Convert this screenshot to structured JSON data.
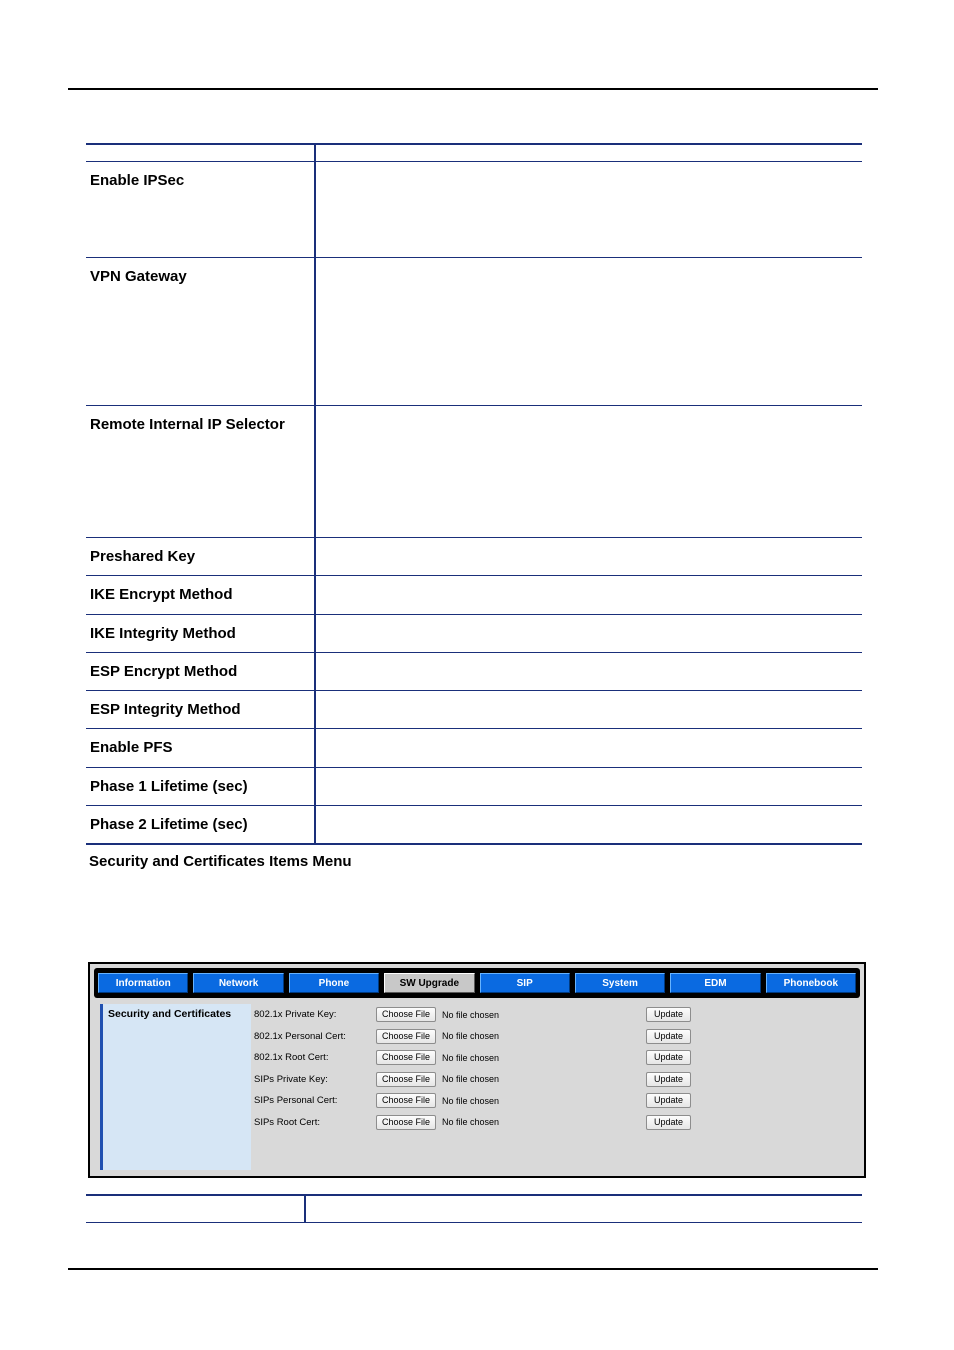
{
  "document": {
    "caption": "Security and Certificates Items Menu",
    "param_table": {
      "rows": [
        {
          "label": "",
          "value": "",
          "header": true
        },
        {
          "label": "Enable IPSec",
          "value": ""
        },
        {
          "label": "VPN Gateway",
          "value": ""
        },
        {
          "label": "Remote Internal IP Selector",
          "value": ""
        },
        {
          "label": "Preshared Key",
          "value": ""
        },
        {
          "label": "IKE Encrypt Method",
          "value": ""
        },
        {
          "label": "IKE Integrity Method",
          "value": ""
        },
        {
          "label": "ESP Encrypt Method",
          "value": ""
        },
        {
          "label": "ESP Integrity Method",
          "value": ""
        },
        {
          "label": "Enable PFS",
          "value": ""
        },
        {
          "label": "Phase 1 Lifetime (sec)",
          "value": ""
        },
        {
          "label": "Phase 2 Lifetime (sec)",
          "value": ""
        }
      ]
    },
    "bottom_table": {
      "label": "",
      "value": ""
    }
  },
  "webui": {
    "tabs": [
      {
        "label": "Information",
        "selected": false
      },
      {
        "label": "Network",
        "selected": false
      },
      {
        "label": "Phone",
        "selected": false
      },
      {
        "label": "SW Upgrade",
        "selected": true
      },
      {
        "label": "SIP",
        "selected": false
      },
      {
        "label": "System",
        "selected": false
      },
      {
        "label": "EDM",
        "selected": false
      },
      {
        "label": "Phonebook",
        "selected": false
      }
    ],
    "sidebar": {
      "title": "Security and Certificates"
    },
    "form": {
      "choose_file_label": "Choose File",
      "no_file_label": "No file chosen",
      "update_label": "Update",
      "rows": [
        {
          "label": "802.1x Private Key:"
        },
        {
          "label": "802.1x Personal Cert:"
        },
        {
          "label": "802.1x Root Cert:"
        },
        {
          "label": "SIPs Private Key:"
        },
        {
          "label": "SIPs Personal Cert:"
        },
        {
          "label": "SIPs Root Cert:"
        }
      ]
    }
  }
}
